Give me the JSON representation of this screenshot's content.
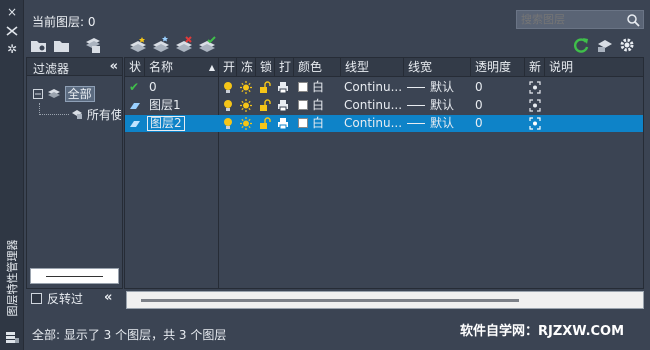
{
  "window": {
    "title": "图层特性管理器",
    "pin_glyph": "×",
    "settings_glyph": "✲"
  },
  "header": {
    "current_layer_label": "当前图层: 0",
    "search_placeholder": "搜索图层"
  },
  "filter_panel": {
    "title": "过滤器",
    "collapse_glyph": "«",
    "tree": [
      {
        "label": "全部",
        "expanded": true
      },
      {
        "label": "所有使用的图层"
      }
    ],
    "invert_label": "反转过",
    "invert_checked": false
  },
  "grid": {
    "columns": [
      "状",
      "名称",
      "开",
      "冻",
      "锁",
      "打",
      "颜色",
      "线型",
      "线宽",
      "透明度",
      "新",
      "说明"
    ],
    "rows": [
      {
        "status": "✔",
        "name": "0",
        "color_name": "白",
        "linetype": "Continu...",
        "lineweight": "默认",
        "transparency": "0",
        "selected": false,
        "current": true
      },
      {
        "status": "",
        "name": "图层1",
        "color_name": "白",
        "linetype": "Continu...",
        "lineweight": "默认",
        "transparency": "0",
        "selected": false,
        "current": false
      },
      {
        "status": "",
        "name": "图层2",
        "color_name": "白",
        "linetype": "Continu...",
        "lineweight": "默认",
        "transparency": "0",
        "selected": true,
        "current": false
      }
    ]
  },
  "status_bar": {
    "text": "全部: 显示了 3 个图层，共 3 个图层"
  },
  "watermark": "软件自学网：RJZXW.COM",
  "colors": {
    "panel_bg": "#3b4453",
    "selected_row": "#0e83c8",
    "bulb": "#f5c518",
    "refresh": "#3fbf4a"
  }
}
